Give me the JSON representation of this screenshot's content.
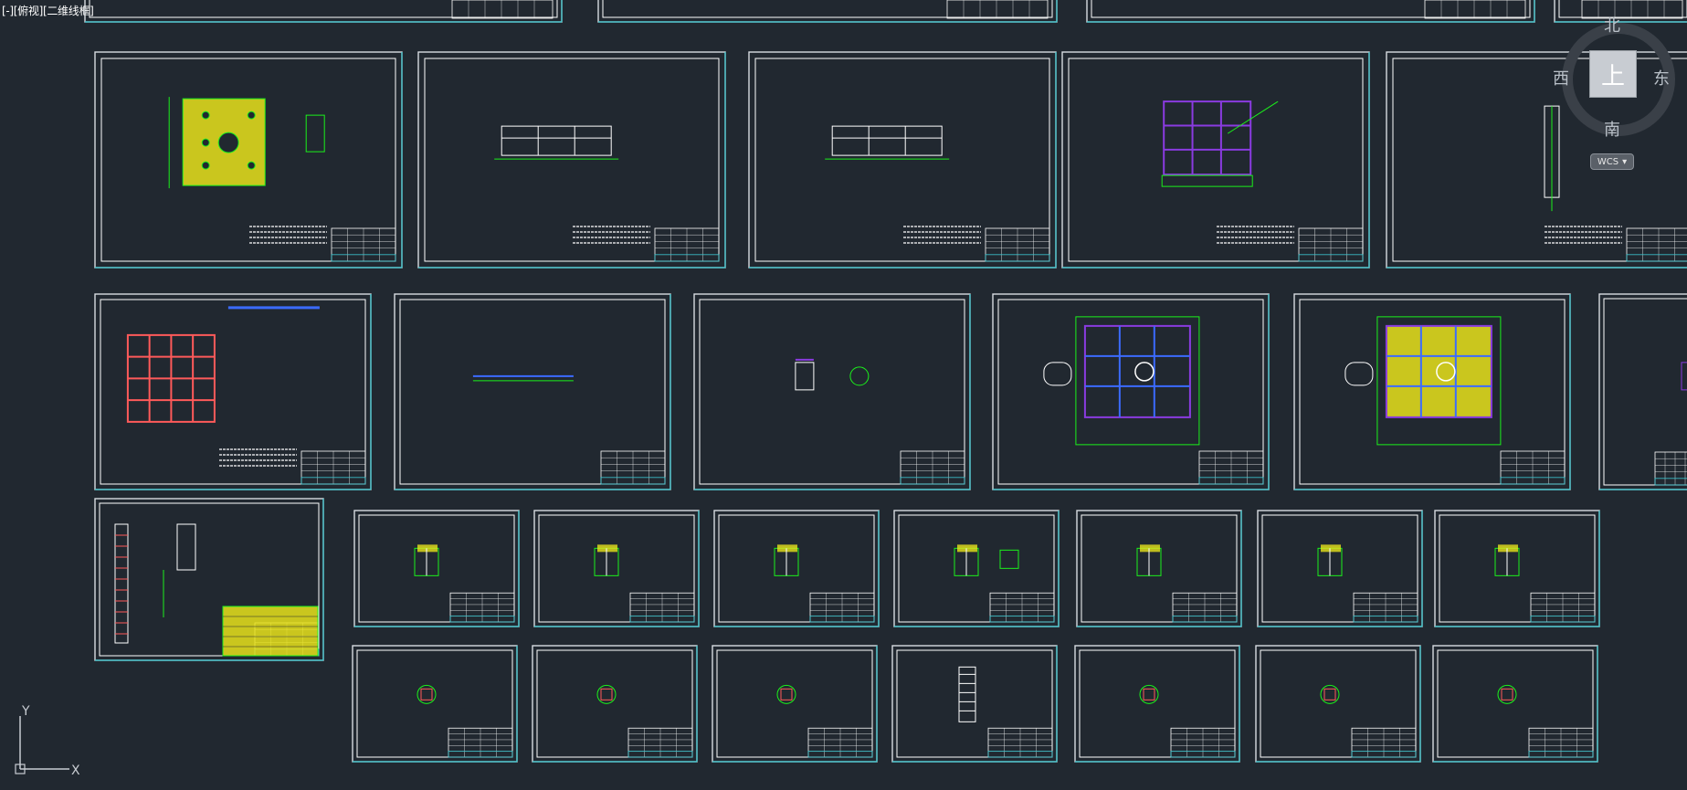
{
  "viewport": {
    "label": "[-][俯视][二维线框]"
  },
  "view_cube": {
    "face": "上",
    "north": "北",
    "south": "南",
    "west": "西",
    "east": "东",
    "wcs_label": "WCS",
    "wcs_icon": "chevron-down-icon"
  },
  "ucs": {
    "x_label": "X",
    "y_label": "Y"
  },
  "colors": {
    "background": "#212830",
    "sheet_outer": "#d8dde2",
    "sheet_inner": "#ffffff",
    "sheet_accent": "#39c6cf",
    "geometry_green": "#1bf11b",
    "fill_yellow": "#e7e21b",
    "member_purple": "#8a3be0",
    "member_red": "#ff5a5a",
    "member_blue": "#3b6bff",
    "axis": "#c8ccd2"
  },
  "sheets": [
    {
      "id": "top-row-1"
    },
    {
      "id": "top-row-2"
    },
    {
      "id": "top-row-3"
    },
    {
      "id": "top-row-4"
    },
    {
      "id": "top-row-5"
    },
    {
      "id": "row1-1"
    },
    {
      "id": "row1-2"
    },
    {
      "id": "row1-3"
    },
    {
      "id": "row1-4"
    },
    {
      "id": "row1-5"
    },
    {
      "id": "row2-1"
    },
    {
      "id": "row2-2"
    },
    {
      "id": "row2-3"
    },
    {
      "id": "row2-4"
    },
    {
      "id": "row2-5"
    },
    {
      "id": "row2-6"
    },
    {
      "id": "row3-large"
    },
    {
      "id": "row3-1"
    },
    {
      "id": "row3-2"
    },
    {
      "id": "row3-3"
    },
    {
      "id": "row3-4"
    },
    {
      "id": "row3-5"
    },
    {
      "id": "row3-6"
    },
    {
      "id": "row3-7"
    },
    {
      "id": "row4-1"
    },
    {
      "id": "row4-2"
    },
    {
      "id": "row4-3"
    },
    {
      "id": "row4-4"
    },
    {
      "id": "row4-5"
    },
    {
      "id": "row4-6"
    },
    {
      "id": "row4-7"
    }
  ]
}
